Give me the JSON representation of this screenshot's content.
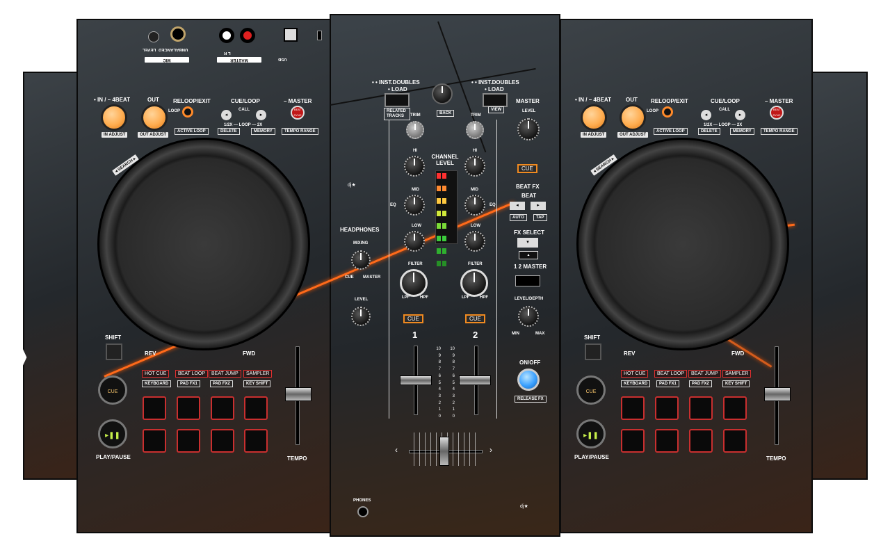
{
  "top_panel": {
    "mic_label": "MIC",
    "mic_level": "LEVEL",
    "unbalanced": "UNBALANCED",
    "master_label": "MASTER",
    "master_lr": "L      R",
    "usb_label": "USB"
  },
  "left_deck": {
    "in_4beat": "• IN / – 4BEAT",
    "out": "OUT",
    "reloop_exit": "RELOOP/EXIT",
    "loop": "LOOP",
    "cue_loop": "CUE/LOOP",
    "call": "CALL",
    "master": "– MASTER",
    "beat_sync": "BEAT SYNC",
    "in_adjust": "IN ADJUST",
    "out_adjust": "OUT ADJUST",
    "active_loop": "ACTIVE LOOP",
    "loop_half": "1/2X — LOOP — 2X",
    "delete": "DELETE",
    "memory": "MEMORY",
    "tempo_range": "TEMPO RANGE",
    "search": "◂ SEARCH ▸",
    "shift": "SHIFT",
    "rev": "REV",
    "fwd": "FWD",
    "hot_cue": "HOT CUE",
    "beat_loop": "BEAT LOOP",
    "beat_jump": "BEAT JUMP",
    "sampler": "SAMPLER",
    "keyboard": "KEYBOARD",
    "pad_fx1": "PAD FX1",
    "pad_fx2": "PAD FX2",
    "key_shift": "KEY SHIFT",
    "cue_button": "CUE",
    "play_pause": "PLAY/PAUSE",
    "tempo": "TEMPO"
  },
  "right_deck": {
    "in_4beat": "• IN / – 4BEAT",
    "out": "OUT",
    "reloop_exit": "RELOOP/EXIT",
    "loop": "LOOP",
    "cue_loop": "CUE/LOOP",
    "call": "CALL",
    "master": "– MASTER",
    "beat_sync": "BEAT SYNC",
    "in_adjust": "IN ADJUST",
    "out_adjust": "OUT ADJUST",
    "active_loop": "ACTIVE LOOP",
    "loop_half": "1/2X — LOOP — 2X",
    "delete": "DELETE",
    "memory": "MEMORY",
    "tempo_range": "TEMPO RANGE",
    "search": "◂ SEARCH ▸",
    "shift": "SHIFT",
    "rev": "REV",
    "fwd": "FWD",
    "hot_cue": "HOT CUE",
    "beat_loop": "BEAT LOOP",
    "beat_jump": "BEAT JUMP",
    "sampler": "SAMPLER",
    "keyboard": "KEYBOARD",
    "pad_fx1": "PAD FX1",
    "pad_fx2": "PAD FX2",
    "key_shift": "KEY SHIFT",
    "cue_button": "CUE",
    "play_pause": "PLAY/PAUSE",
    "tempo": "TEMPO"
  },
  "mixer": {
    "inst_doubles_left": "• • INST.DOUBLES",
    "load_left": "• LOAD",
    "related_tracks": "RELATED TRACKS",
    "back": "BACK",
    "inst_doubles_right": "• • INST.DOUBLES",
    "load_right": "• LOAD",
    "view": "VIEW",
    "trim": "TRIM",
    "hi": "HI",
    "mid": "MID",
    "low": "LOW",
    "eq": "EQ",
    "filter": "FILTER",
    "lpf": "LPF",
    "hpf": "HPF",
    "channel_level": "CHANNEL LEVEL",
    "headphones": "HEADPHONES",
    "mixing": "MIXING",
    "cue": "CUE",
    "master": "MASTER",
    "level": "LEVEL",
    "ch1": "1",
    "ch2": "2",
    "master_section": "MASTER",
    "master_level": "LEVEL",
    "master_cue": "CUE",
    "beat_fx": "BEAT FX",
    "beat": "BEAT",
    "auto": "AUTO",
    "tap": "TAP",
    "fx_select": "FX SELECT",
    "fx_channel": "1   2  MASTER",
    "level_depth": "LEVEL/DEPTH",
    "min": "MIN",
    "max": "MAX",
    "on_off": "ON/OFF",
    "release_fx": "RELEASE FX",
    "phones": "PHONES",
    "fader_scale": [
      "10",
      "9",
      "8",
      "7",
      "6",
      "5",
      "4",
      "3",
      "2",
      "1",
      "0"
    ]
  },
  "colors": {
    "accent_orange": "#ff6a1a",
    "pad_red": "#c92f2f",
    "cue_blue": "#3aa0ff"
  }
}
